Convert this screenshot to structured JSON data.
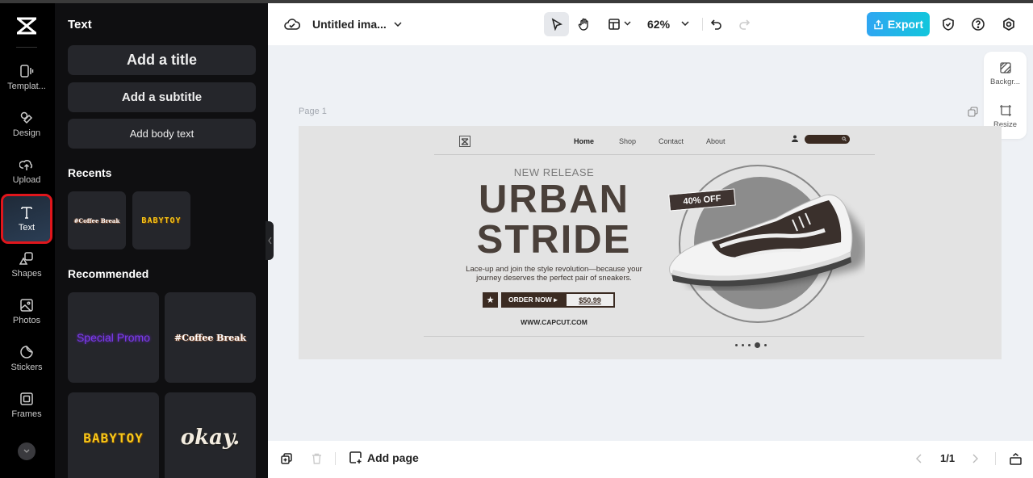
{
  "rail": {
    "items": [
      {
        "label": "Templat...",
        "icon": "templates-icon"
      },
      {
        "label": "Design",
        "icon": "design-icon"
      },
      {
        "label": "Upload",
        "icon": "upload-icon"
      },
      {
        "label": "Text",
        "icon": "text-icon",
        "active": true
      },
      {
        "label": "Shapes",
        "icon": "shapes-icon"
      },
      {
        "label": "Photos",
        "icon": "photos-icon"
      },
      {
        "label": "Stickers",
        "icon": "stickers-icon"
      },
      {
        "label": "Frames",
        "icon": "frames-icon"
      }
    ],
    "more_icon": "chevron-down-icon"
  },
  "panel": {
    "title": "Text",
    "add_title": "Add a title",
    "add_subtitle": "Add a subtitle",
    "add_body": "Add body text",
    "recents_heading": "Recents",
    "recents": [
      "#Coffee Break",
      "BABYTOY"
    ],
    "recommended_heading": "Recommended",
    "recommended": [
      "Special Promo",
      "#Coffee Break",
      "BABYTOY",
      "okay."
    ]
  },
  "topbar": {
    "doc_title": "Untitled ima...",
    "zoom": "62%",
    "export_label": "Export",
    "colors": {
      "export_start": "#2fa6f2",
      "export_end": "#12c6dc"
    }
  },
  "canvas": {
    "page_label": "Page 1",
    "side_actions": [
      {
        "label": "Backgr..."
      },
      {
        "label": "Resize"
      }
    ]
  },
  "design": {
    "nav": [
      "Home",
      "Shop",
      "Contact",
      "About"
    ],
    "active_nav": "Home",
    "kicker": "NEW RELEASE",
    "headline_1": "URBAN",
    "headline_2": "STRIDE",
    "tagline_1": "Lace-up and join the style revolution—because your",
    "tagline_2": "journey deserves the perfect pair of sneakers.",
    "star": "★",
    "cta": "ORDER NOW ▸",
    "price": "$50.99",
    "website": "WWW.CAPCUT.COM",
    "badge": "40% OFF",
    "carousel_active_index": 3,
    "carousel_count": 5,
    "colors": {
      "brand_dark": "#3b2b22",
      "headline": "#4a403a"
    }
  },
  "bottombar": {
    "add_page_label": "Add page",
    "page_count": "1/1"
  }
}
